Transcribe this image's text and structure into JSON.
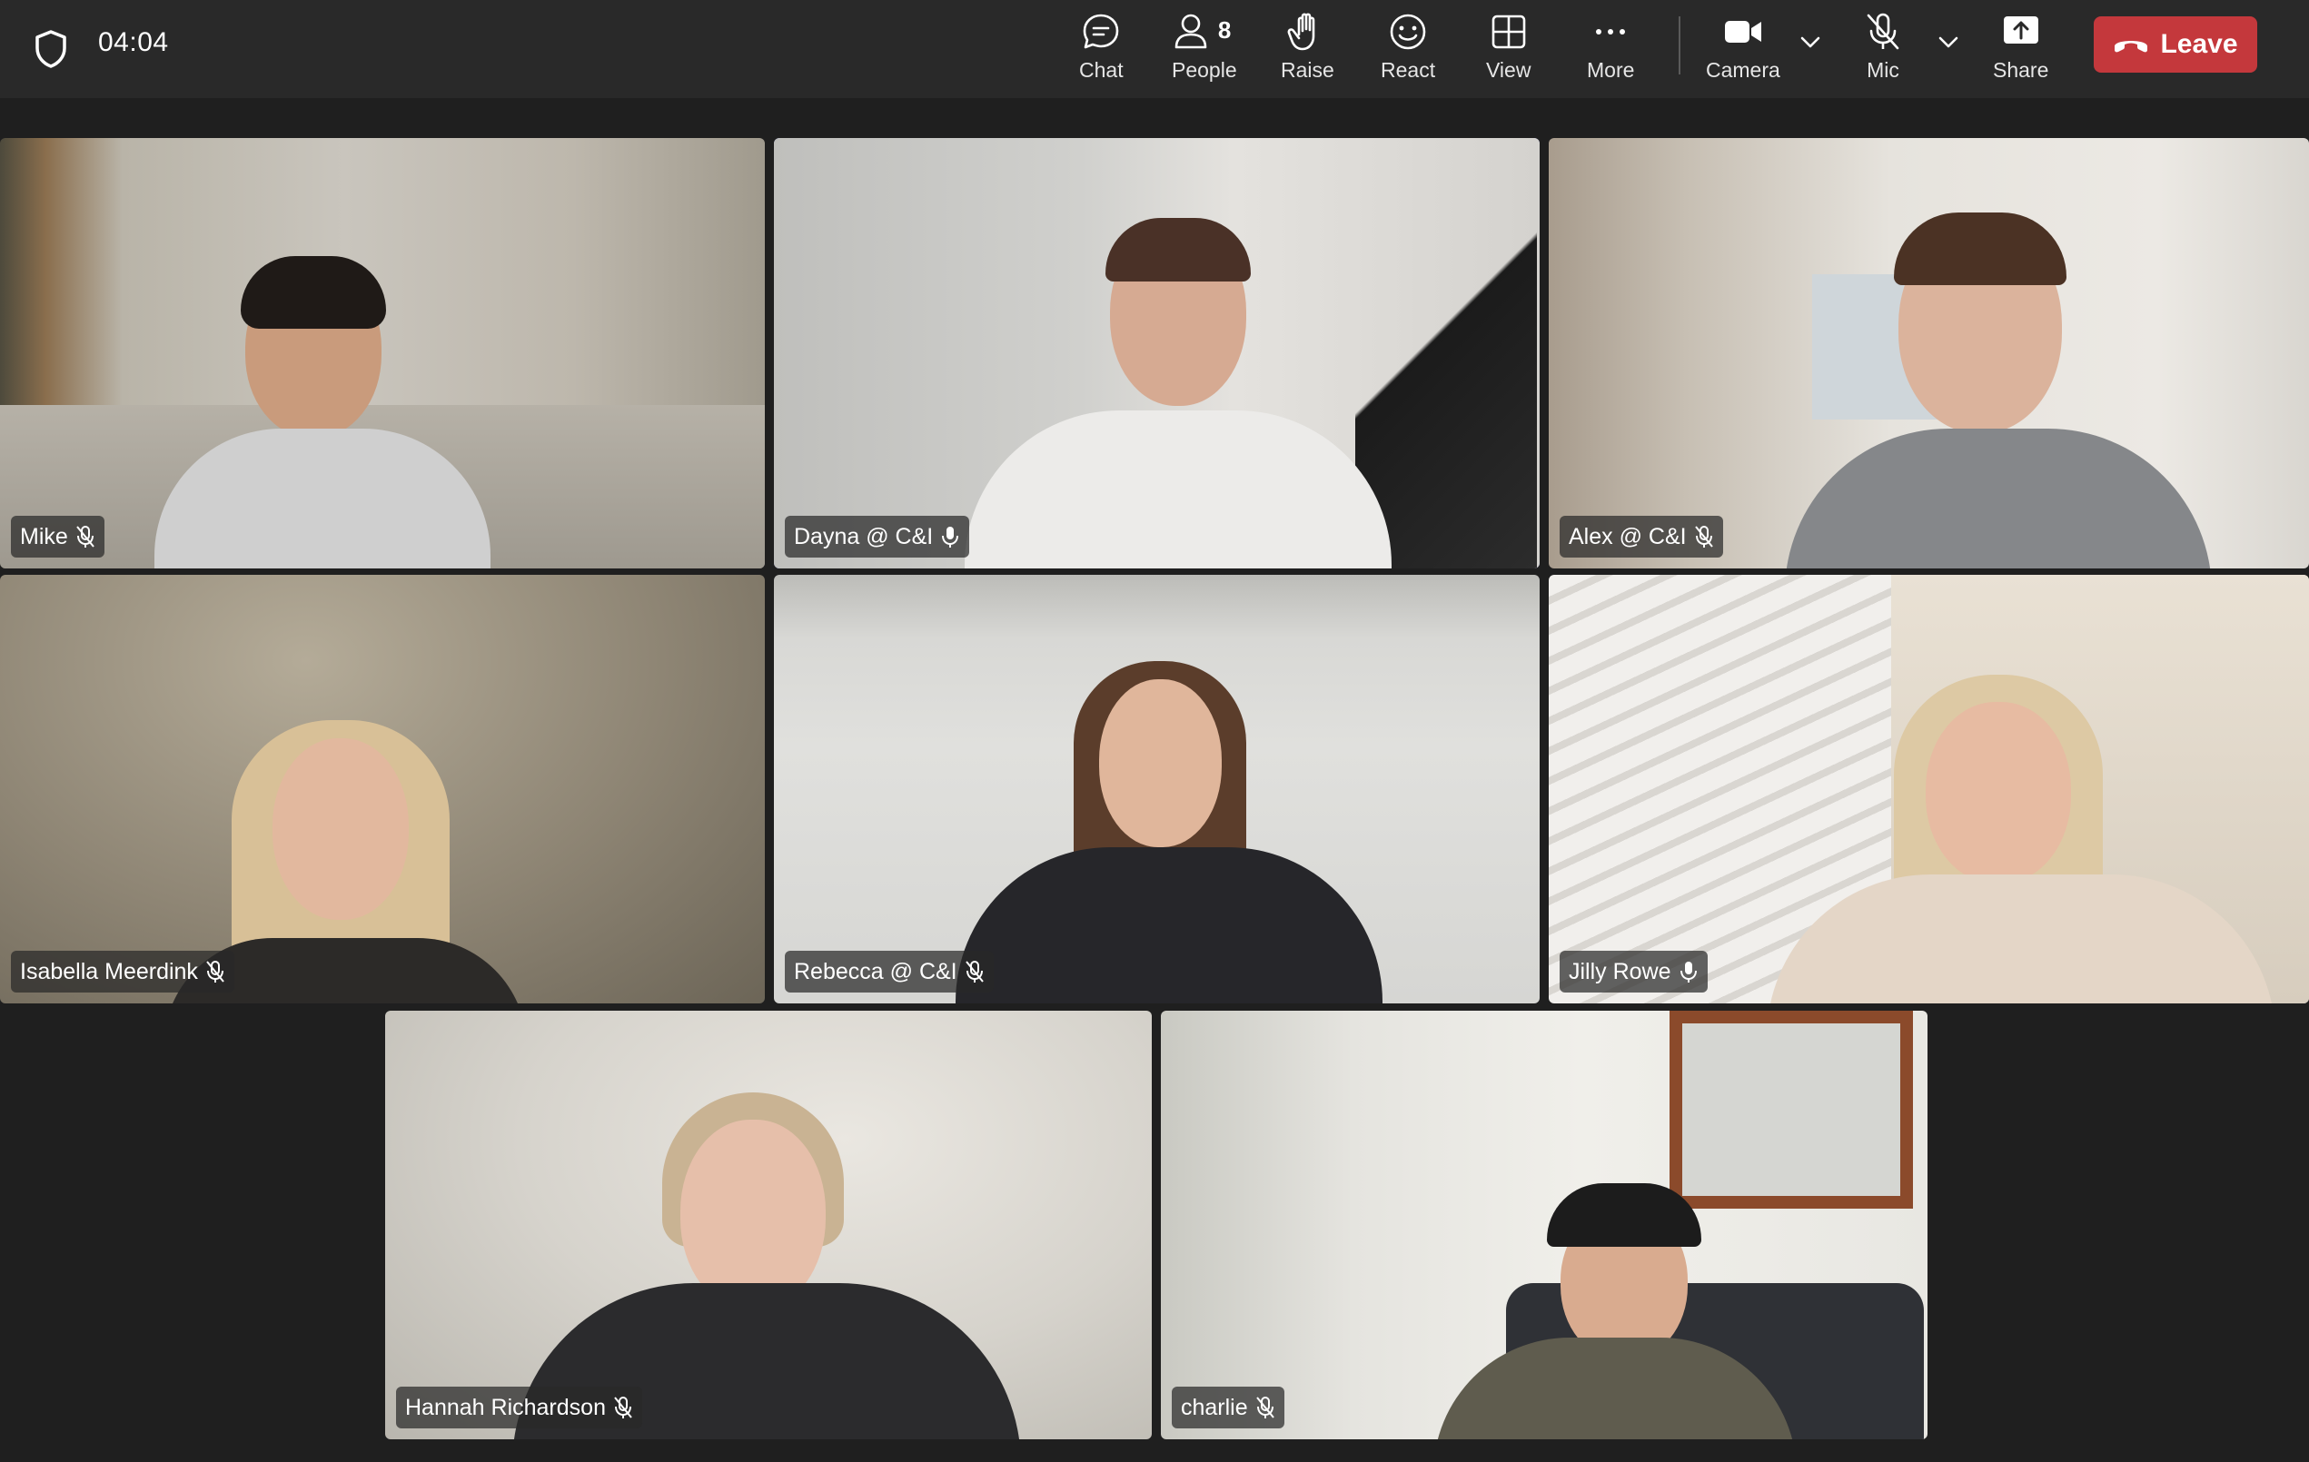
{
  "timer": "04:04",
  "toolbar": {
    "chat": "Chat",
    "people": "People",
    "people_count": "8",
    "raise": "Raise",
    "react": "React",
    "view": "View",
    "more": "More",
    "camera": "Camera",
    "mic": "Mic",
    "share": "Share",
    "leave": "Leave"
  },
  "participants": [
    {
      "name": "Mike",
      "mic": "muted"
    },
    {
      "name": "Dayna @ C&I",
      "mic": "on"
    },
    {
      "name": "Alex @ C&I",
      "mic": "muted"
    },
    {
      "name": "Isabella Meerdink",
      "mic": "muted"
    },
    {
      "name": "Rebecca @ C&I",
      "mic": "muted"
    },
    {
      "name": "Jilly Rowe",
      "mic": "on"
    },
    {
      "name": "Hannah Richardson",
      "mic": "muted"
    },
    {
      "name": "charlie",
      "mic": "muted"
    }
  ],
  "colors": {
    "accent": "#7f85f5",
    "leave": "#c4383c",
    "toolbar": "#292929",
    "background": "#1f1f1f"
  }
}
